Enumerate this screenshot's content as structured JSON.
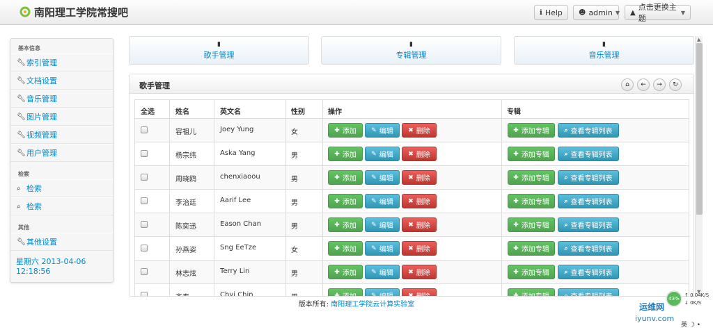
{
  "app": {
    "title": "南阳理工学院常搜吧"
  },
  "topbar": {
    "help_label": "Help",
    "user_label": "admin",
    "theme_label": "点击更换主题"
  },
  "sidebar": {
    "sections": [
      {
        "heading": "基本信息",
        "items": [
          {
            "label": "索引管理",
            "icon": "wrench-icon"
          },
          {
            "label": "文档设置",
            "icon": "wrench-icon"
          },
          {
            "label": "音乐管理",
            "icon": "wrench-icon"
          },
          {
            "label": "图片管理",
            "icon": "wrench-icon"
          },
          {
            "label": "视频管理",
            "icon": "wrench-icon"
          },
          {
            "label": "用户管理",
            "icon": "wrench-icon"
          }
        ]
      },
      {
        "heading": "检索",
        "items": [
          {
            "label": "检索",
            "icon": "search-icon"
          },
          {
            "label": "检索",
            "icon": "search-icon"
          }
        ]
      },
      {
        "heading": "其他",
        "items": [
          {
            "label": "其他设置",
            "icon": "wrench-icon"
          }
        ]
      }
    ],
    "datetime": "星期六 2013-04-06 12:18:56"
  },
  "cards": [
    {
      "label": "歌手管理",
      "icon": "book-icon"
    },
    {
      "label": "专辑管理",
      "icon": "book-icon"
    },
    {
      "label": "音乐管理",
      "icon": "book-icon"
    }
  ],
  "panel": {
    "title": "歌手管理",
    "columns": [
      "全选",
      "姓名",
      "英文名",
      "性别",
      "操作",
      "专辑"
    ],
    "actions": {
      "add": "添加",
      "edit": "编辑",
      "delete": "删除",
      "add_album": "添加专辑",
      "view_albums": "查看专辑列表"
    },
    "rows": [
      {
        "name": "容祖儿",
        "english": "Joey Yung",
        "gender": "女"
      },
      {
        "name": "杨宗纬",
        "english": "Aska Yang",
        "gender": "男"
      },
      {
        "name": "周晓鸥",
        "english": "chenxiaoou",
        "gender": "男"
      },
      {
        "name": "李治廷",
        "english": "Aarif Lee",
        "gender": "男"
      },
      {
        "name": "陈奕迅",
        "english": "Eason Chan",
        "gender": "男"
      },
      {
        "name": "孙燕姿",
        "english": "Sng EeTze",
        "gender": "女"
      },
      {
        "name": "林志炫",
        "english": "Terry Lin",
        "gender": "男"
      },
      {
        "name": "齐秦",
        "english": "Chyi Chin",
        "gender": "男"
      }
    ]
  },
  "footer": {
    "prefix": "版本所有:",
    "link": "南阳理工学院云计算实验室"
  },
  "overlay": {
    "percent": "43%",
    "up_speed": "0.04K/S",
    "down_speed": "0K/S",
    "watermark": "运维网",
    "watermark_url": "iyunv.com",
    "ime": "英"
  },
  "colors": {
    "link": "#0088cc",
    "success": "#51a351",
    "info": "#2f96b4",
    "danger": "#bd362f"
  }
}
